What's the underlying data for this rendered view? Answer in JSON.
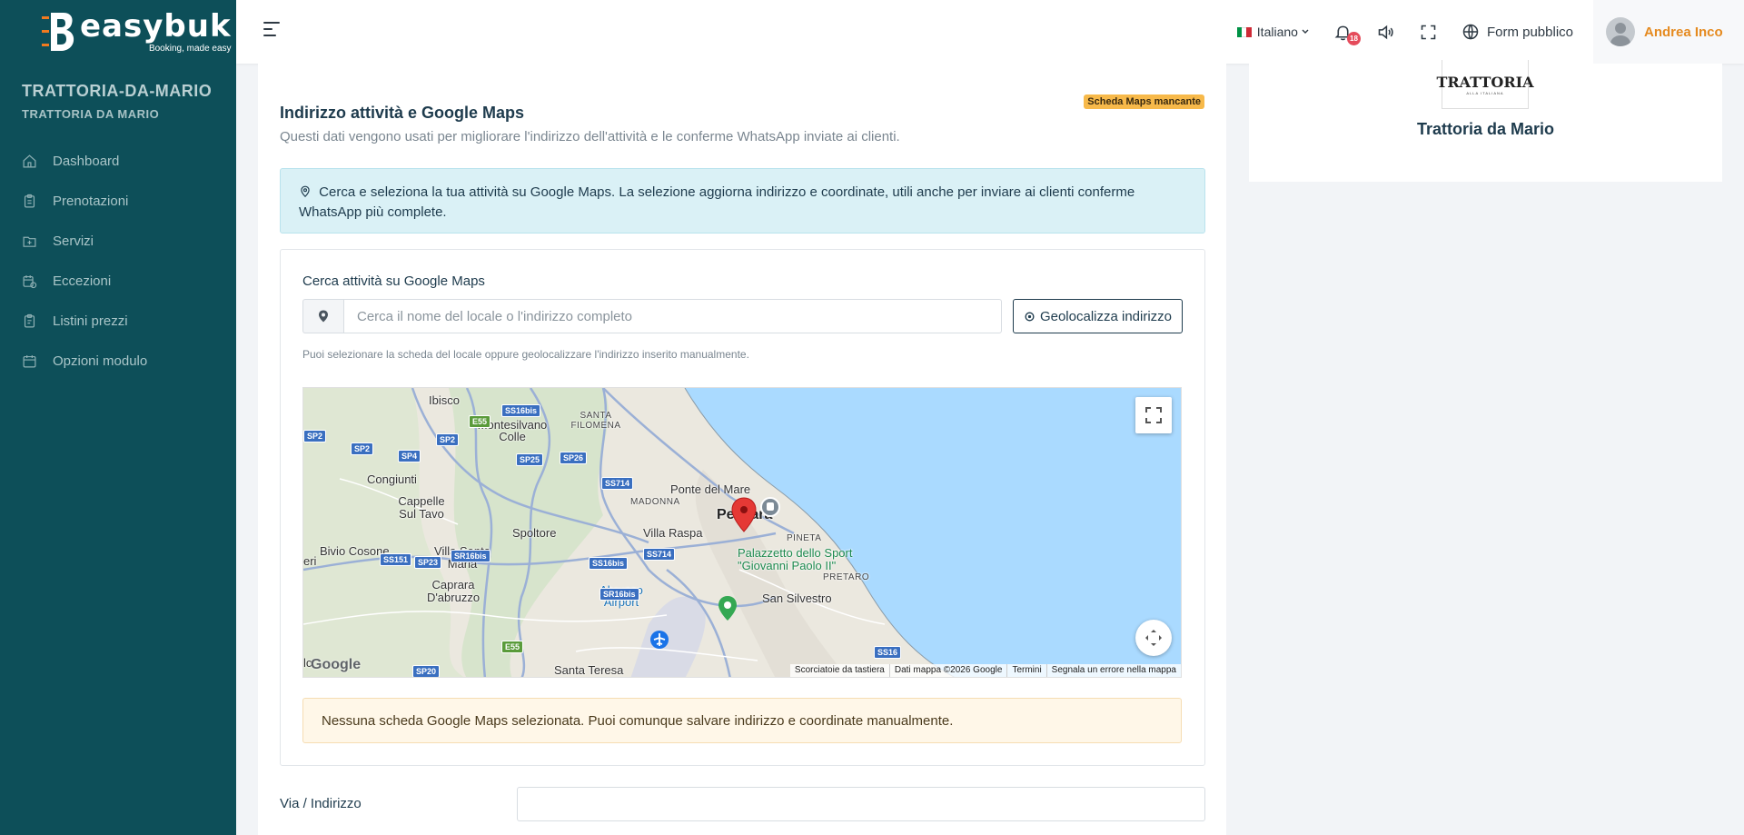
{
  "brand": {
    "name": "easybuk",
    "tagline": "Booking, made easy"
  },
  "sidebar": {
    "business_name": "TRATTORIA-DA-MARIO",
    "business_sub": "TRATTORIA DA MARIO",
    "items": [
      {
        "label": "Dashboard",
        "icon": "home-icon"
      },
      {
        "label": "Prenotazioni",
        "icon": "clipboard-icon"
      },
      {
        "label": "Servizi",
        "icon": "folder-plus-icon"
      },
      {
        "label": "Eccezioni",
        "icon": "calendar-exception-icon"
      },
      {
        "label": "Listini prezzi",
        "icon": "clipboard-list-icon"
      },
      {
        "label": "Opzioni modulo",
        "icon": "calendar-icon"
      }
    ]
  },
  "topbar": {
    "language": "Italiano",
    "notification_count": "18",
    "public_form": "Form pubblico",
    "user_name": "Andrea Inco"
  },
  "main": {
    "title": "Indirizzo attività e Google Maps",
    "subtitle": "Questi dati vengono usati per migliorare l'indirizzo dell'attività e le conferme WhatsApp inviate ai clienti.",
    "status_badge": "Scheda Maps mancante",
    "info": "Cerca e seleziona la tua attività su Google Maps. La selezione aggiorna indirizzo e coordinate, utili anche per inviare ai clienti conferme WhatsApp più complete.",
    "search_label": "Cerca attività su Google Maps",
    "search_placeholder": "Cerca il nome del locale o l'indirizzo completo",
    "geolocate_button": "Geolocalizza indirizzo",
    "hint": "Puoi selezionare la scheda del locale oppure geolocalizzare l'indirizzo inserito manualmente.",
    "notice": "Nessuna scheda Google Maps selezionata. Puoi comunque salvare indirizzo e coordinate manualmente.",
    "address_label": "Via / Indirizzo"
  },
  "map": {
    "places": [
      "Ibisco",
      "Montesilvano Colle",
      "SANTA FILOMENA",
      "Congiunti",
      "Cappelle Sul Tavo",
      "MADONNA",
      "Ponte del Mare",
      "Pescara",
      "Bivio Cosone",
      "Villa Santa Maria",
      "Spoltore",
      "Villa Raspa",
      "PINETA",
      "Palazzetto dello Sport \"Giovanni Paolo II\"",
      "Caprara D'abruzzo",
      "Abruzzo Airport",
      "PRETARO",
      "San Silvestro",
      "Santa Teresa"
    ],
    "roads": [
      "SS16bis",
      "E55",
      "SP2",
      "SP4",
      "SP25",
      "SP26",
      "SS714",
      "SS151",
      "SP23",
      "SR16bis",
      "SS16",
      "SP20"
    ],
    "footer": [
      "Scorciatoie da tastiera",
      "Dati mappa ©2026 Google",
      "Termini",
      "Segnala un errore nella mappa"
    ],
    "logo": "Google",
    "fragments": [
      "eri",
      "lc"
    ]
  },
  "side": {
    "logo_text": "TRATTORIA",
    "logo_sub": "ALLA ITALIANA",
    "name": "Trattoria da Mario"
  },
  "colors": {
    "sidebar": "#0d4f59",
    "accent": "#e58a1f",
    "badge": "#f7b94a",
    "info_bg": "#daf1f6",
    "notice_bg": "#fff7e8"
  }
}
